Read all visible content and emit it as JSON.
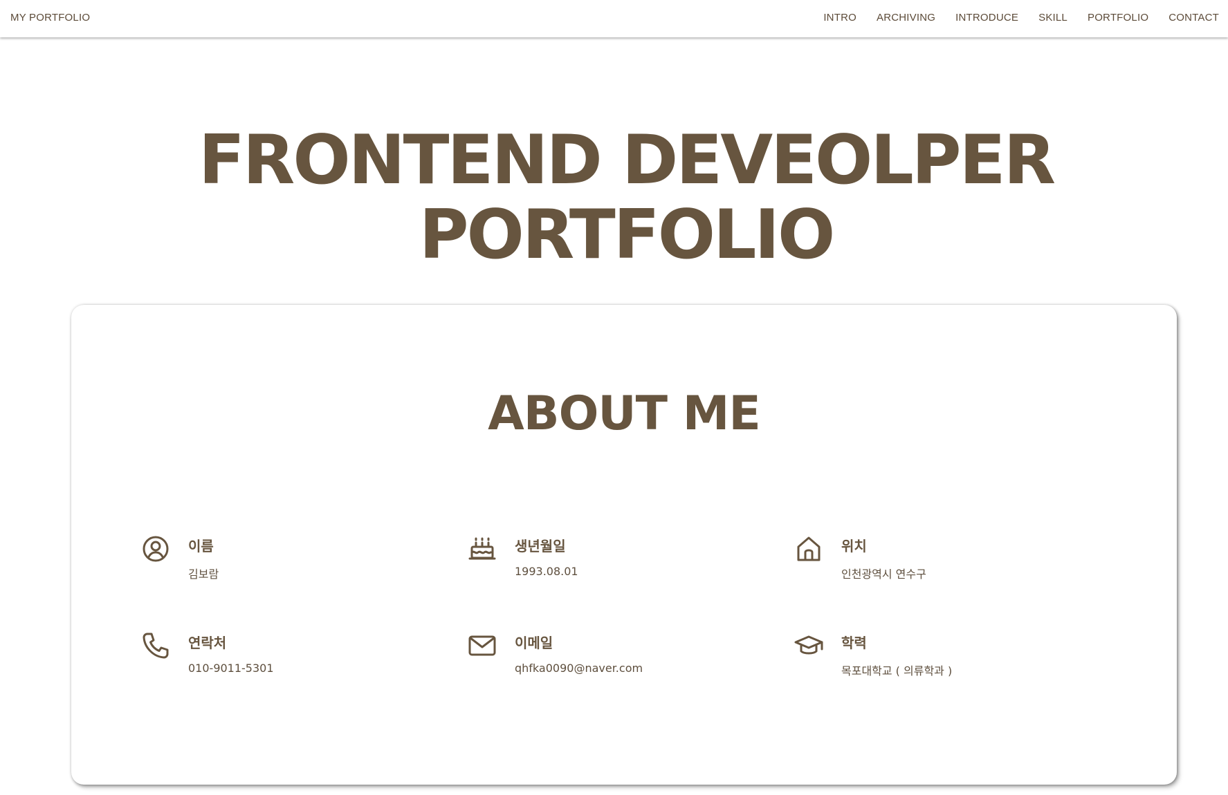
{
  "navbar": {
    "brand": "MY PORTFOLIO",
    "items": [
      {
        "label": "INTRO"
      },
      {
        "label": "ARCHIVING"
      },
      {
        "label": "INTRODUCE"
      },
      {
        "label": "SKILL"
      },
      {
        "label": "PORTFOLIO"
      },
      {
        "label": "CONTACT"
      }
    ]
  },
  "hero": {
    "title_line1": "FRONTEND DEVEOLPER",
    "title_line2": "PORTFOLIO"
  },
  "about": {
    "title": "ABOUT ME",
    "items": [
      {
        "icon": "user-circle-icon",
        "label": "이름",
        "value": "김보람"
      },
      {
        "icon": "birthday-cake-icon",
        "label": "생년월일",
        "value": "1993.08.01"
      },
      {
        "icon": "home-icon",
        "label": "위치",
        "value": "인천광역시 연수구"
      },
      {
        "icon": "phone-icon",
        "label": "연락처",
        "value": "010-9011-5301"
      },
      {
        "icon": "mail-icon",
        "label": "이메일",
        "value": "qhfka0090@naver.com"
      },
      {
        "icon": "graduation-cap-icon",
        "label": "학력",
        "value": "목포대학교 ( 의류학과 )"
      }
    ]
  },
  "colors": {
    "accent": "#67553f",
    "background": "#ffffff"
  }
}
